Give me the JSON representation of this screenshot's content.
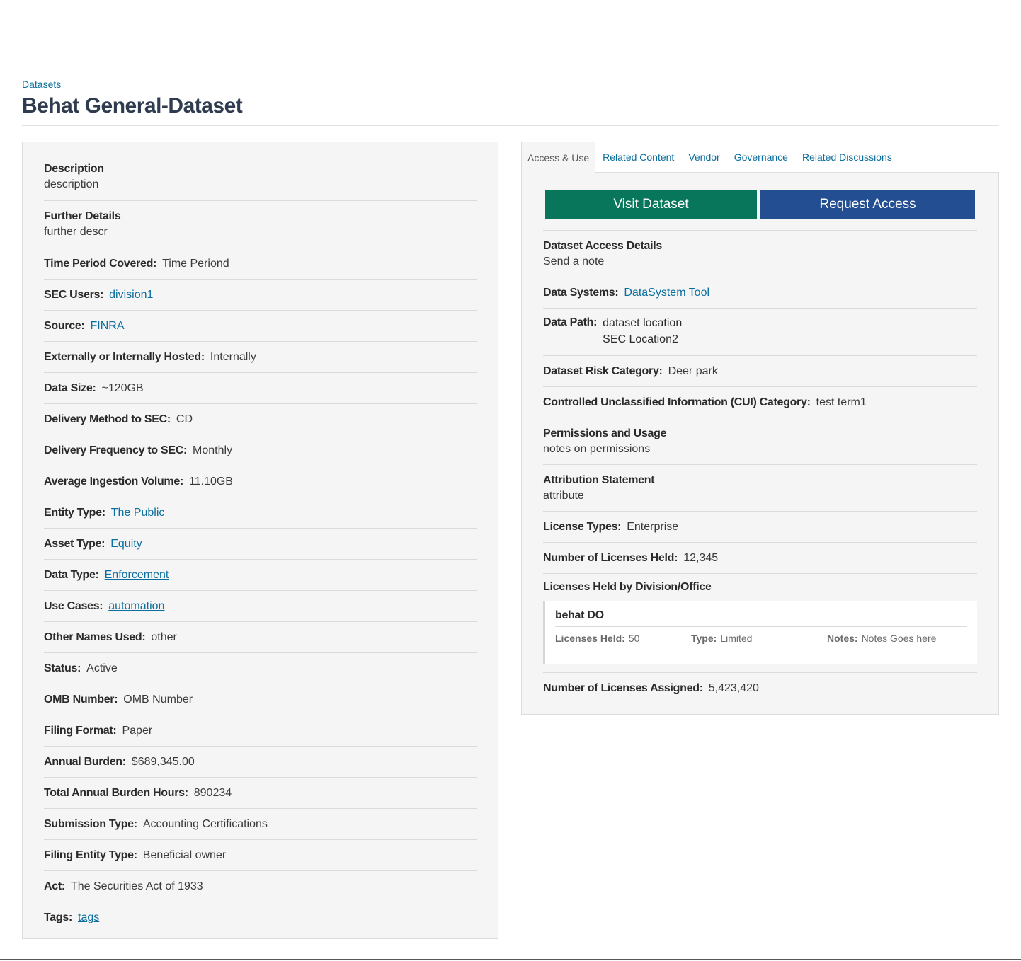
{
  "breadcrumb": "Datasets",
  "title": "Behat General-Dataset",
  "left": {
    "description": {
      "label": "Description",
      "value": "description"
    },
    "further_details": {
      "label": "Further Details",
      "value": "further descr"
    },
    "rows": [
      {
        "label": "Time Period Covered:",
        "value": "Time Periond"
      },
      {
        "label": "SEC Users:",
        "value": "division1"
      },
      {
        "label": "Source:",
        "value": "FINRA"
      },
      {
        "label": "Externally or Internally Hosted:",
        "value": "Internally"
      },
      {
        "label": "Data Size:",
        "value": "~120GB"
      },
      {
        "label": "Delivery Method to SEC:",
        "value": "CD"
      },
      {
        "label": "Delivery Frequency to SEC:",
        "value": "Monthly"
      },
      {
        "label": "Average Ingestion Volume:",
        "value": "11.10GB"
      },
      {
        "label": "Entity Type:",
        "value": "The Public"
      },
      {
        "label": "Asset Type:",
        "value": "Equity"
      },
      {
        "label": "Data Type:",
        "value": "Enforcement"
      },
      {
        "label": "Use Cases:",
        "value": "automation"
      },
      {
        "label": "Other Names Used:",
        "value": "other"
      },
      {
        "label": "Status:",
        "value": "Active"
      },
      {
        "label": "OMB Number:",
        "value": "OMB Number"
      },
      {
        "label": "Filing Format:",
        "value": "Paper"
      },
      {
        "label": "Annual Burden:",
        "value": "$689,345.00"
      },
      {
        "label": "Total Annual Burden Hours:",
        "value": "890234"
      },
      {
        "label": "Submission Type:",
        "value": "Accounting Certifications"
      },
      {
        "label": "Filing Entity Type:",
        "value": "Beneficial owner"
      },
      {
        "label": "Act:",
        "value": "The Securities Act of 1933"
      },
      {
        "label": "Tags:",
        "value": "tags"
      }
    ]
  },
  "tabs": [
    "Access & Use",
    "Related Content",
    "Vendor",
    "Governance",
    "Related Discussions"
  ],
  "right": {
    "visit_button": "Visit Dataset",
    "request_button": "Request Access",
    "access_details": {
      "label": "Dataset Access Details",
      "value": "Send a note"
    },
    "data_systems": {
      "label": "Data Systems:",
      "value": "DataSystem Tool"
    },
    "data_path": {
      "label": "Data Path:",
      "values": [
        "dataset location",
        "SEC Location2"
      ]
    },
    "risk_category": {
      "label": "Dataset Risk Category:",
      "value": "Deer park"
    },
    "cui_category": {
      "label": "Controlled Unclassified Information (CUI) Category:",
      "value": "test term1"
    },
    "permissions": {
      "label": "Permissions and Usage",
      "value": "notes on permissions"
    },
    "attribution": {
      "label": "Attribution Statement",
      "value": "attribute"
    },
    "license_types": {
      "label": "License Types:",
      "value": "Enterprise"
    },
    "licenses_held": {
      "label": "Number of Licenses Held:",
      "value": "12,345"
    },
    "licenses_by_division": {
      "label": "Licenses Held by Division/Office",
      "card": {
        "name": "behat DO",
        "held_label": "Licenses Held:",
        "held_value": "50",
        "type_label": "Type:",
        "type_value": "Limited",
        "notes_label": "Notes:",
        "notes_value": "Notes Goes here"
      }
    },
    "licenses_assigned": {
      "label": "Number of Licenses Assigned:",
      "value": "5,423,420"
    }
  },
  "colors": {
    "visit": "#07765a",
    "request": "#234f92",
    "link": "#0b6e9e"
  }
}
